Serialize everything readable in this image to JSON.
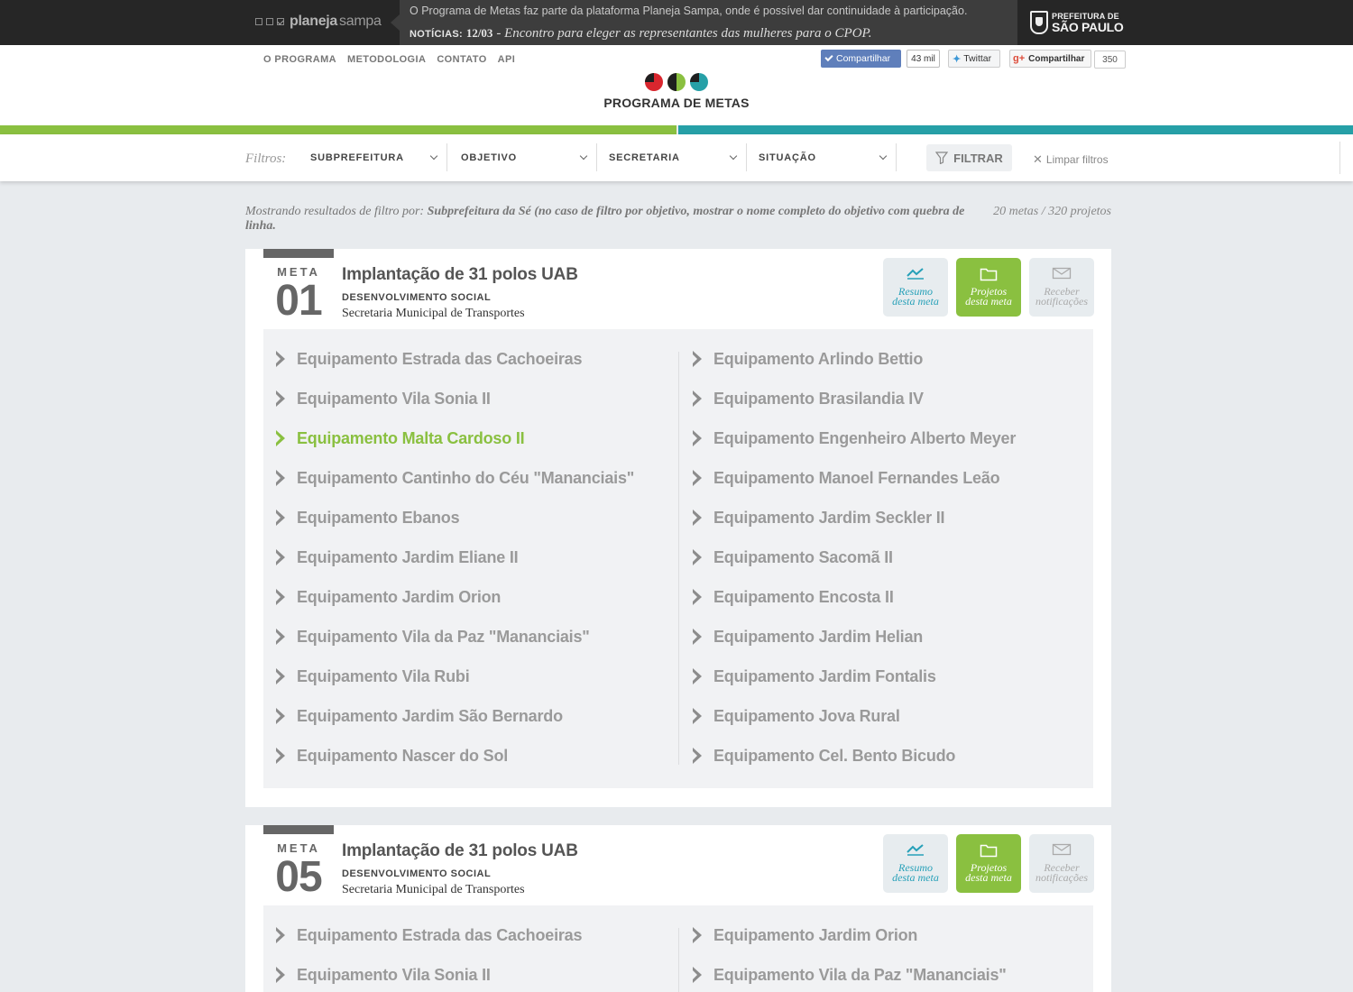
{
  "topbar": {
    "brand_a": "planeja",
    "brand_b": "sampa",
    "info": "O Programa de Metas faz parte da plataforma Planeja Sampa, onde é possível dar continuidade à participação.",
    "news_label": "NOTÍCIAS:",
    "news_date": "12/03",
    "news_text": "- Encontro para eleger as representantes das mulheres para o CPOP.",
    "pref_small": "PREFEITURA DE",
    "pref_big": "SÃO PAULO"
  },
  "nav": [
    "O PROGRAMA",
    "METODOLOGIA",
    "CONTATO",
    "API"
  ],
  "social": {
    "fb_label": "Compartilhar",
    "fb_count": "43 mil",
    "tw_label": "Twittar",
    "gp_label": "Compartilhar",
    "gp_count": "350"
  },
  "logo_title": "PROGRAMA DE METAS",
  "colors": {
    "green": "#8ac040",
    "teal": "#26a0a7",
    "red": "#d9262e",
    "dark": "#262626"
  },
  "filters": {
    "label": "Filtros:",
    "selects": [
      "SUBPREFEITURA",
      "OBJETIVO",
      "SECRETARIA",
      "SITUAÇÃO"
    ],
    "filter_button": "FILTRAR",
    "clear": "Limpar filtros"
  },
  "results": {
    "prefix": "Mostrando resultados de filtro por:",
    "value": "Subprefeitura da Sé (no caso de filtro por objetivo, mostrar o nome completo do objetivo com quebra de linha.",
    "counts": "20 metas / 320 projetos"
  },
  "cards": [
    {
      "meta_word": "META",
      "meta_num": "01",
      "title": "Implantação de 31 polos UAB",
      "objective": "DESENVOLVIMENTO SOCIAL",
      "secretaria": "Secretaria Municipal de Transportes",
      "actions": {
        "resumo_1": "Resumo",
        "resumo_2": "desta meta",
        "projetos_1": "Projetos",
        "projetos_2": "desta meta",
        "receber_1": "Receber",
        "receber_2": "notificações"
      },
      "left_items": [
        "Equipamento Estrada das Cachoeiras",
        "Equipamento Vila Sonia II",
        "Equipamento Malta Cardoso II",
        "Equipamento Cantinho do Céu \"Mananciais\"",
        "Equipamento Ebanos",
        "Equipamento Jardim Eliane II",
        "Equipamento Jardim Orion",
        "Equipamento Vila da Paz \"Mananciais\"",
        "Equipamento Vila Rubi",
        "Equipamento Jardim São Bernardo",
        "Equipamento Nascer do Sol"
      ],
      "right_items": [
        "Equipamento Arlindo Bettio",
        "Equipamento Brasilandia IV",
        "Equipamento Engenheiro Alberto Meyer",
        "Equipamento Manoel Fernandes Leão",
        "Equipamento Jardim Seckler II",
        "Equipamento Sacomã II",
        "Equipamento Encosta II",
        "Equipamento Jardim Helian",
        "Equipamento Jardim Fontalis",
        "Equipamento Jova Rural",
        "Equipamento Cel. Bento Bicudo"
      ]
    },
    {
      "meta_word": "META",
      "meta_num": "05",
      "title": "Implantação de 31 polos UAB",
      "objective": "DESENVOLVIMENTO SOCIAL",
      "secretaria": "Secretaria Municipal de Transportes",
      "actions": {
        "resumo_1": "Resumo",
        "resumo_2": "desta meta",
        "projetos_1": "Projetos",
        "projetos_2": "desta meta",
        "receber_1": "Receber",
        "receber_2": "notificações"
      },
      "left_items": [
        "Equipamento Estrada das Cachoeiras",
        "Equipamento Vila Sonia II"
      ],
      "right_items": [
        "Equipamento Jardim Orion",
        "Equipamento Vila da Paz \"Mananciais\""
      ]
    }
  ]
}
